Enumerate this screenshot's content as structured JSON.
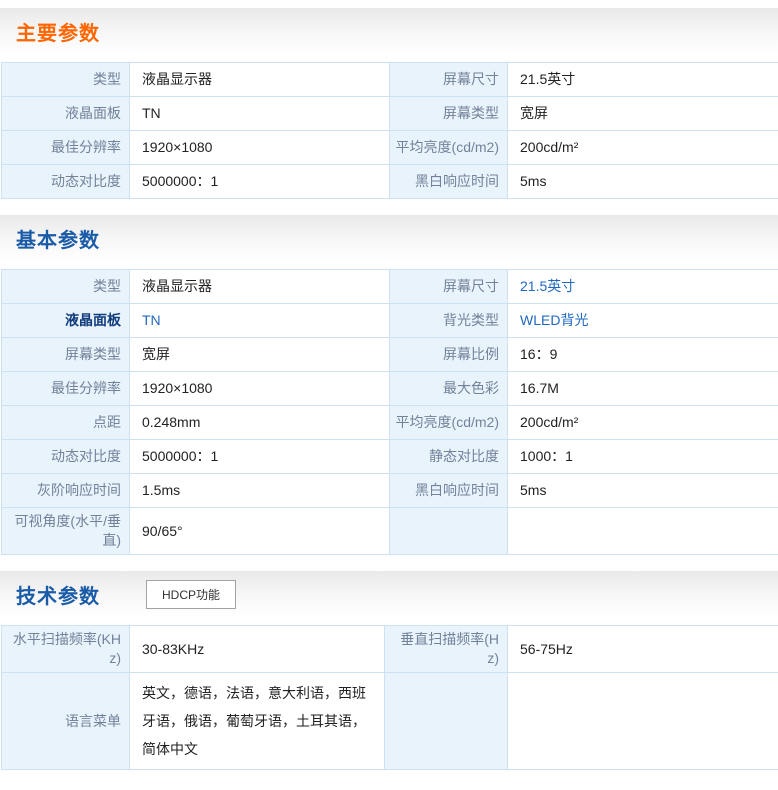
{
  "colors": {
    "main_title_orange": "#ff6600",
    "section_title_blue": "#1a5ba8",
    "label_bg": "#e9f3fc",
    "label_text": "#72829a",
    "cell_border": "#cde1f3",
    "link_text": "#2069c0",
    "bold_label_text": "#123d7d"
  },
  "sections": [
    {
      "title": "主要参数",
      "rows": [
        {
          "l1": "类型",
          "v1": "液晶显示器",
          "l2": "屏幕尺寸",
          "v2": "21.5英寸"
        },
        {
          "l1": "液晶面板",
          "v1": "TN",
          "l2": "屏幕类型",
          "v2": "宽屏"
        },
        {
          "l1": "最佳分辨率",
          "v1": "1920×1080",
          "l2": "平均亮度(cd/m2)",
          "v2": "200cd/m²"
        },
        {
          "l1": "动态对比度",
          "v1": "5000000：1",
          "l2": "黑白响应时间",
          "v2": "5ms"
        }
      ]
    },
    {
      "title": "基本参数",
      "rows": [
        {
          "l1": "类型",
          "v1": "液晶显示器",
          "l2": "屏幕尺寸",
          "v2": "21.5英寸"
        },
        {
          "l1": "液晶面板",
          "v1": "TN",
          "l2": "背光类型",
          "v2": "WLED背光"
        },
        {
          "l1": "屏幕类型",
          "v1": "宽屏",
          "l2": "屏幕比例",
          "v2": "16：9"
        },
        {
          "l1": "最佳分辨率",
          "v1": "1920×1080",
          "l2": "最大色彩",
          "v2": "16.7M"
        },
        {
          "l1": "点距",
          "v1": "0.248mm",
          "l2": "平均亮度(cd/m2)",
          "v2": "200cd/m²"
        },
        {
          "l1": "动态对比度",
          "v1": "5000000：1",
          "l2": "静态对比度",
          "v2": "1000：1"
        },
        {
          "l1": "灰阶响应时间",
          "v1": "1.5ms",
          "l2": "黑白响应时间",
          "v2": "5ms"
        },
        {
          "l1": "可视角度(水平/垂直)",
          "v1": "90/65°",
          "l2": "",
          "v2": ""
        }
      ]
    },
    {
      "title": "技术参数",
      "button_label": "HDCP功能",
      "rows": [
        {
          "l1": "水平扫描频率(KHz)",
          "v1": "30-83KHz",
          "l2": "垂直扫描频率(Hz)",
          "v2": "56-75Hz"
        },
        {
          "l1": "语言菜单",
          "v1": "英文，德语，法语，意大利语，西班牙语，俄语，葡萄牙语，土耳其语，简体中文",
          "l2": "",
          "v2": ""
        }
      ]
    }
  ]
}
